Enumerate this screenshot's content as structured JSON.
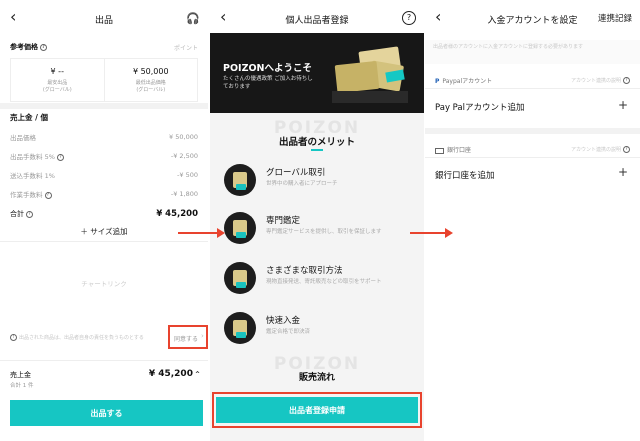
{
  "screen1": {
    "title": "出品",
    "ref_price_label": "参考価格",
    "ref_price_link": "ポイント",
    "left_price": "¥ --",
    "left_caption_1": "最安出品",
    "left_caption_2": "(グローバル)",
    "right_price": "¥ 50,000",
    "right_caption_1": "最低出品価格",
    "right_caption_2": "(グローバル)",
    "sales_section_title": "売上金 / 個",
    "rows": [
      {
        "label": "出品価格",
        "value": "¥ 50,000"
      },
      {
        "label": "出品手数料 5%",
        "value": "-¥ 2,500"
      },
      {
        "label": "送込手数料 1%",
        "value": "-¥ 500"
      },
      {
        "label": "作業手数料",
        "value": "-¥ 1,800"
      }
    ],
    "total_label": "合計",
    "total_value": "¥ 45,200",
    "add_size": "＋ サイズ追加",
    "chart_link": "チャートリンク",
    "notice": "出品された商品は、出品者自身の責任を負うものとする",
    "notice_link": "同意する",
    "footer_label": "売上金",
    "footer_sub": "合計 1 件",
    "footer_value": "¥ 45,200",
    "submit_label": "出品する"
  },
  "screen2": {
    "title": "個人出品者登録",
    "banner_title": "POIZONへようこそ",
    "banner_text": "たくさんの優遇政策 ご加入お待ちしております",
    "watermark": "POIZON",
    "merits_title": "出品者のメリット",
    "merits": [
      {
        "title": "グローバル取引",
        "desc": "世界中の購入者にアプローチ"
      },
      {
        "title": "専門鑑定",
        "desc": "専門鑑定サービスを提供し、取引を保証します"
      },
      {
        "title": "さまざまな取引方法",
        "desc": "現物直接発送、寄託販売などの取引をサポート"
      },
      {
        "title": "快速入金",
        "desc": "鑑定合格で即決済"
      }
    ],
    "watermark2": "POIZON",
    "flow_title": "販売流れ",
    "apply_label": "出品者登録申請"
  },
  "screen3": {
    "title": "入金アカウントを設定",
    "history_link": "連携記録",
    "notice": "出品者様のアカウントに入金アカウントに登録する必要があります",
    "paypal_section": "Paypalアカウント",
    "paypal_note": "アカウント連携の説明",
    "paypal_add": "Pay Palアカウント追加",
    "bank_section": "銀行口座",
    "bank_note": "アカウント連携の説明",
    "bank_add": "銀行口座を追加"
  }
}
